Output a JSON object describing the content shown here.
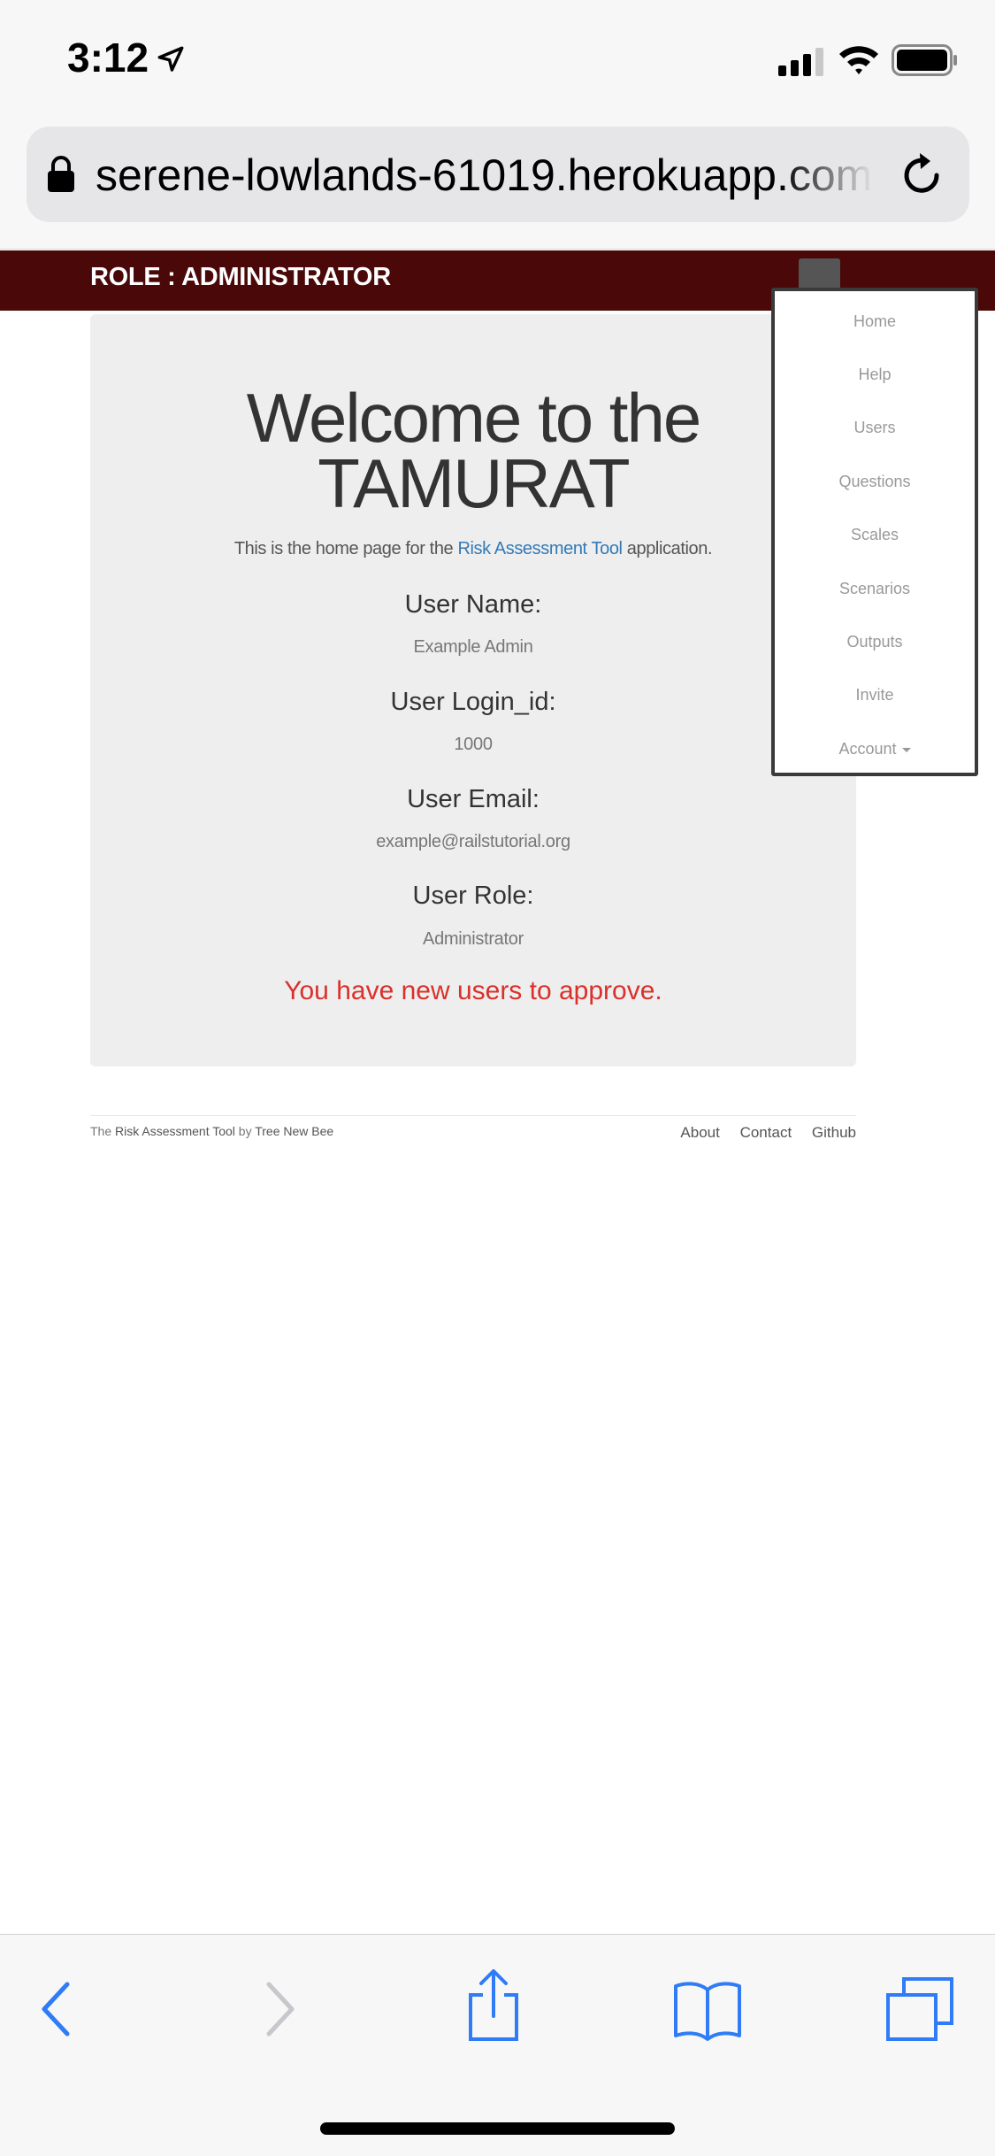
{
  "status_bar": {
    "time": "3:12",
    "icons": [
      "location-arrow-icon",
      "cellular-signal-icon",
      "wifi-icon",
      "battery-icon"
    ]
  },
  "browser": {
    "url": "serene-lowlands-61019.herokuapp.com",
    "icons": [
      "lock-icon",
      "reload-icon"
    ]
  },
  "navbar": {
    "role_label": "ROLE : ADMINISTRATOR",
    "bg_color": "#4a0808"
  },
  "main": {
    "welcome_line1": "Welcome to the",
    "welcome_line2": "TAMURAT",
    "intro_before": "This is the home page for the ",
    "intro_link": "Risk Assessment Tool",
    "intro_after": " application.",
    "fields": [
      {
        "label": "User Name:",
        "value": "Example Admin"
      },
      {
        "label": "User Login_id:",
        "value": "1000"
      },
      {
        "label": "User Email:",
        "value": "example@railstutorial.org"
      },
      {
        "label": "User Role:",
        "value": "Administrator"
      }
    ],
    "alert": "You have new users to approve.",
    "alert_color": "#d9312b"
  },
  "footer": {
    "prefix": "The ",
    "app_link": "Risk Assessment Tool",
    "by": " by ",
    "team_link": "Tree New Bee",
    "links": [
      "About",
      "Contact",
      "Github"
    ]
  },
  "dropdown": {
    "items": [
      "Home",
      "Help",
      "Users",
      "Questions",
      "Scales",
      "Scenarios",
      "Outputs",
      "Invite",
      "Account"
    ]
  },
  "toolbar": {
    "icons": [
      "back-icon",
      "forward-icon",
      "share-icon",
      "bookmarks-icon",
      "tabs-icon"
    ],
    "accent": "#2f7cf6"
  }
}
